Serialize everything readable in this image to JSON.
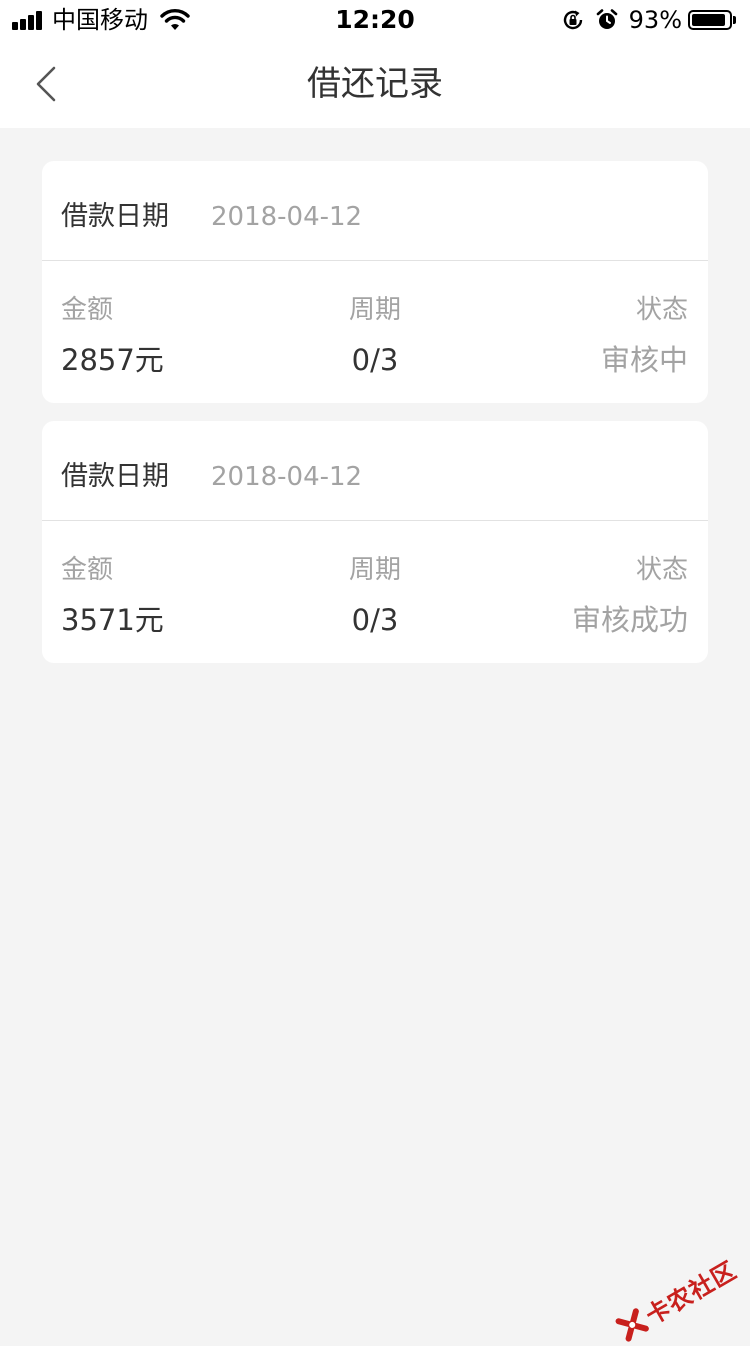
{
  "status_bar": {
    "carrier": "中国移动",
    "time": "12:20",
    "battery_percent": "93%",
    "battery_level": 0.93,
    "icons": [
      "signal-icon",
      "wifi-icon",
      "rotation-lock-icon",
      "alarm-icon",
      "battery-icon"
    ]
  },
  "nav": {
    "title": "借还记录",
    "back_icon": "chevron-left-icon"
  },
  "records": [
    {
      "date_label": "借款日期",
      "date": "2018-04-12",
      "amount_label": "金额",
      "amount": "2857元",
      "period_label": "周期",
      "period": "0/3",
      "status_label": "状态",
      "status": "审核中"
    },
    {
      "date_label": "借款日期",
      "date": "2018-04-12",
      "amount_label": "金额",
      "amount": "3571元",
      "period_label": "周期",
      "period": "0/3",
      "status_label": "状态",
      "status": "审核成功"
    }
  ],
  "watermark": {
    "text": "卡农社区",
    "color": "#c8201d"
  }
}
